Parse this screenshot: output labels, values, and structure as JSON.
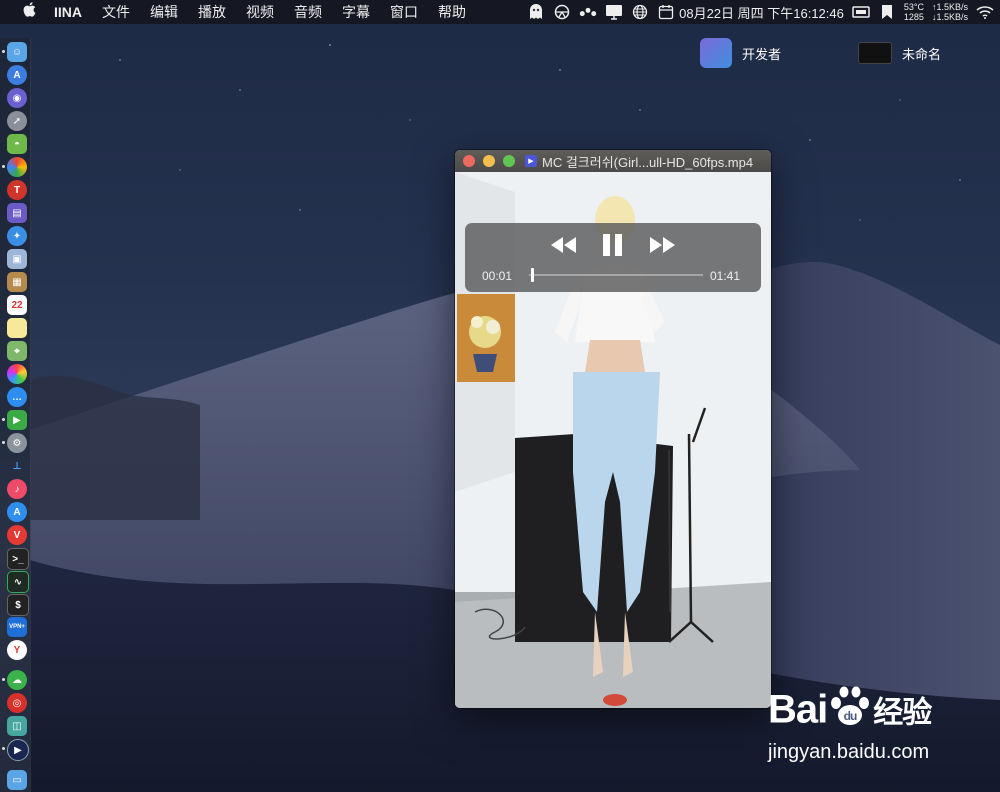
{
  "menubar": {
    "app_name": "IINA",
    "items": [
      "文件",
      "编辑",
      "播放",
      "视频",
      "音频",
      "字幕",
      "窗口",
      "帮助"
    ],
    "datetime": "08月22日 周四 下午16:12:46",
    "temp": "53°C",
    "fan": "1285",
    "net_up": "↑1.5KB/s",
    "net_down": "↓1.5KB/s"
  },
  "desktop": {
    "items": [
      {
        "label": "开发者"
      },
      {
        "label": "未命名"
      }
    ]
  },
  "dock": {
    "calendar_day": "22",
    "vpn_label": "VPN+"
  },
  "player": {
    "title": "MC 걸크러쉬(Girl...ull-HD_60fps.mp4",
    "current_time": "00:01",
    "duration": "01:41",
    "progress": 0.01
  },
  "watermark": {
    "brand": "Bai",
    "brand_cn": "经验",
    "url": "jingyan.baidu.com"
  },
  "colors": {
    "menubar_bg": "#14161e",
    "traffic_red": "#ed6a5e",
    "traffic_yellow": "#f5bf4f",
    "traffic_green": "#61c554"
  }
}
